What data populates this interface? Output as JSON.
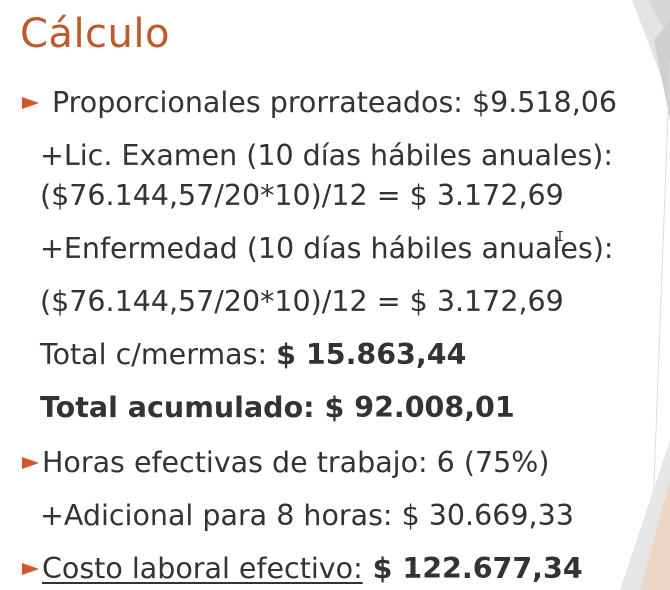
{
  "slide": {
    "title": "Cálculo",
    "lines": [
      {
        "text": "Proporcionales prorrateados: $9.518,06"
      },
      {
        "text": "+Lic. Examen (10 días hábiles anuales):"
      },
      {
        "text": "($76.144,57/20*10)/12 = $ 3.172,69"
      },
      {
        "text": "+Enfermedad (10 días hábiles anuales):"
      },
      {
        "text": "($76.144,57/20*10)/12 = $ 3.172,69"
      },
      {
        "prefix": "Total c/mermas: ",
        "value": "$ 15.863,44"
      },
      {
        "text": "Total acumulado: $ 92.008,01"
      },
      {
        "text": "Horas efectivas de trabajo: 6 (75%)"
      },
      {
        "text": "+Adicional para 8 horas: $ 30.669,33"
      },
      {
        "label": "Costo laboral efectivo:",
        "value": " $ 122.677,34"
      }
    ]
  },
  "colors": {
    "title": "#c0582b",
    "bullet": "#d2552b",
    "text": "#333333"
  }
}
